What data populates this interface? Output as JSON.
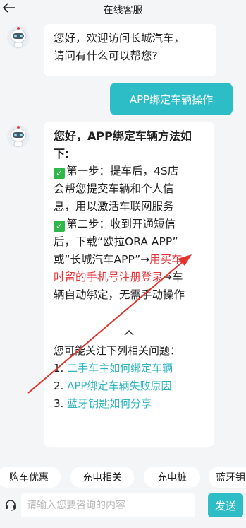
{
  "header": {
    "back_icon": "back-arrow-icon",
    "title": "在线客服"
  },
  "messages": {
    "greeting": {
      "line1": "您好，欢迎访问长城汽车，",
      "line2": "请问有什么可以帮您?"
    },
    "user_query": "APP绑定车辆操作",
    "answer": {
      "head1": "您好，APP绑定车辆方法如",
      "head2": "下:",
      "step1_lines": [
        "第一步：提车后，4S店",
        "会帮您提交车辆和个人信",
        "息，用以激活车联网服务"
      ],
      "step2_l1": "第二步：收到开通短信",
      "step2_l2": "后，下载“欧拉ORA APP”",
      "step2_l3a": "或“长城汽车APP”→",
      "step2_l3b": "用买车",
      "step2_l4a": "时留的手机号注册登录",
      "step2_l4b": "→车",
      "step2_l5": "辆自动绑定，无需手动操作",
      "check_icon": "check-icon",
      "collapse_icon": "chevron-up-icon",
      "related_title": "您可能关注下列相关问题：",
      "related": [
        {
          "num": "1. ",
          "text": "二手车主如何绑定车辆"
        },
        {
          "num": "2. ",
          "text": "APP绑定车辆失败原因"
        },
        {
          "num": "3. ",
          "text": "蓝牙钥匙如何分享"
        }
      ]
    }
  },
  "quick_chips": [
    "购车优惠",
    "充电相关",
    "充电桩",
    "蓝牙钥"
  ],
  "input_bar": {
    "headset_icon": "headset-icon",
    "placeholder": "请输入您要咨询的内容",
    "send_label": "发送"
  },
  "colors": {
    "accent": "#2dbdc6",
    "link": "#2db5c0",
    "highlight": "#e5343a",
    "check": "#2fb84a",
    "annotation_arrow": "#e0342e"
  }
}
